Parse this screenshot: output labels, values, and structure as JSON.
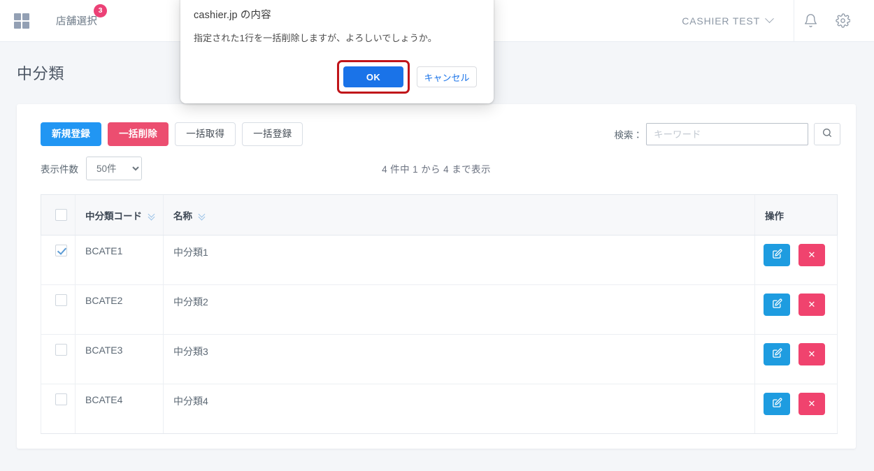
{
  "header": {
    "grid_icon": "grid-icon",
    "store_select_label": "店舗選択",
    "store_badge_count": "3",
    "user_name": "CASHIER  TEST",
    "bell_icon": "bell-icon",
    "gear_icon": "gear-icon",
    "chevron_icon": "chevron-down-icon"
  },
  "page": {
    "title": "中分類"
  },
  "toolbar": {
    "new_label": "新規登録",
    "bulk_delete_label": "一括削除",
    "bulk_get_label": "一括取得",
    "bulk_register_label": "一括登録",
    "search_label": "検索：",
    "search_value": "",
    "search_placeholder": "キーワード",
    "search_icon": "search-icon"
  },
  "subbar": {
    "page_size_label": "表示件数",
    "page_size_value": "50件",
    "page_size_options": [
      "50件"
    ],
    "count_info": "4 件中 1 から 4 まで表示"
  },
  "table": {
    "columns": [
      {
        "key": "check",
        "label": "",
        "sortable": false
      },
      {
        "key": "code",
        "label": "中分類コード",
        "sortable": true
      },
      {
        "key": "name",
        "label": "名称",
        "sortable": true
      },
      {
        "key": "ops",
        "label": "操作",
        "sortable": false
      }
    ],
    "header_checkbox_checked": false,
    "rows": [
      {
        "checked": true,
        "code": "BCATE1",
        "name": "中分類1",
        "edit_label": "",
        "delete_label": "✕"
      },
      {
        "checked": false,
        "code": "BCATE2",
        "name": "中分類2",
        "edit_label": "",
        "delete_label": "✕"
      },
      {
        "checked": false,
        "code": "BCATE3",
        "name": "中分類3",
        "edit_label": "",
        "delete_label": "✕"
      },
      {
        "checked": false,
        "code": "BCATE4",
        "name": "中分類4",
        "edit_label": "",
        "delete_label": "✕"
      }
    ]
  },
  "dialog": {
    "title": "cashier.jp の内容",
    "message": "指定された1行を一括削除しますが、よろしいでしょうか。",
    "ok_label": "OK",
    "cancel_label": "キャンセル",
    "highlight_color": "#c0151a",
    "ok_color": "#1a73e8"
  },
  "colors": {
    "accent_blue": "#2196f3",
    "accent_pink": "#ec4e70",
    "edit_blue": "#1e9ce0",
    "delete_pink": "#f0436e",
    "badge_pink": "#ec4176",
    "page_bg": "#f4f6f9"
  }
}
